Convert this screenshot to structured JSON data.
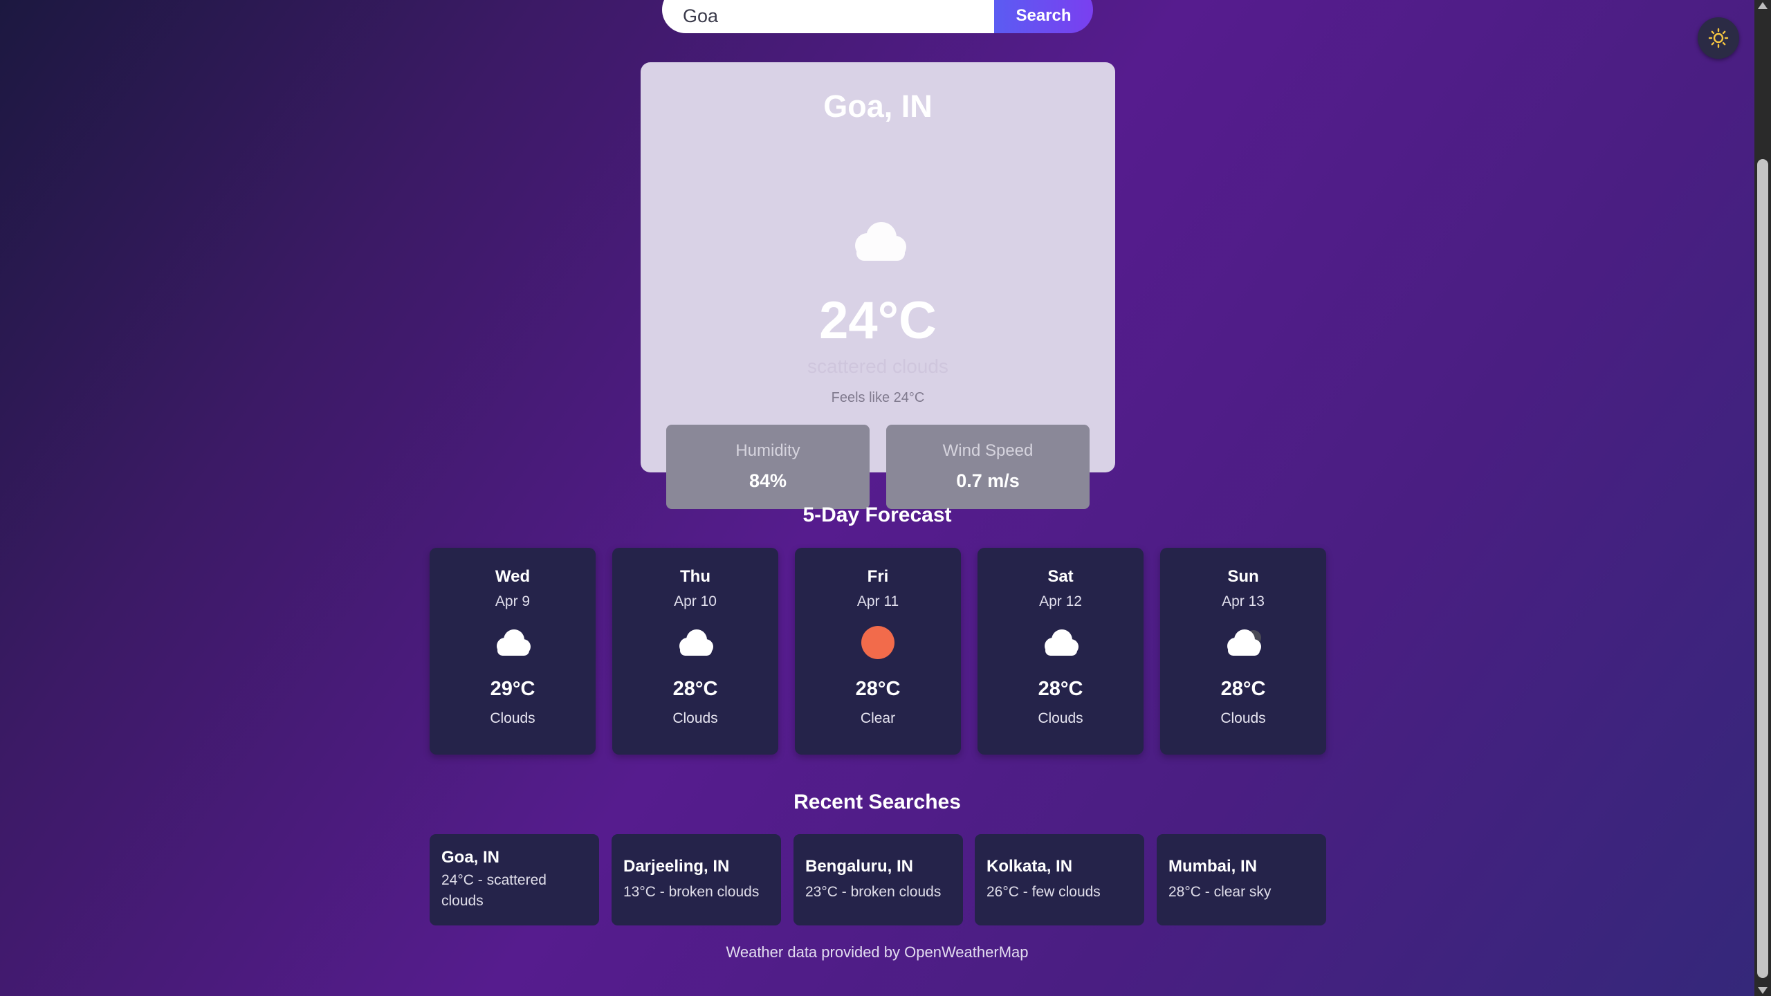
{
  "search": {
    "value": "Goa",
    "button_label": "Search"
  },
  "theme_toggle": {
    "icon": "sun-icon",
    "icon_color": "#f5c542"
  },
  "current": {
    "city": "Goa, IN",
    "icon": "cloud-icon",
    "temperature": "24°C",
    "description": "scattered clouds",
    "feels_like": "Feels like 24°C",
    "humidity_label": "Humidity",
    "humidity_value": "84%",
    "wind_label": "Wind Speed",
    "wind_value": "0.7 m/s"
  },
  "forecast": {
    "title": "5-Day Forecast",
    "days": [
      {
        "day": "Wed",
        "date": "Apr 9",
        "icon": "cloud-icon",
        "temp": "29°C",
        "condition": "Clouds"
      },
      {
        "day": "Thu",
        "date": "Apr 10",
        "icon": "cloud-icon",
        "temp": "28°C",
        "condition": "Clouds"
      },
      {
        "day": "Fri",
        "date": "Apr 11",
        "icon": "sun-icon",
        "temp": "28°C",
        "condition": "Clear"
      },
      {
        "day": "Sat",
        "date": "Apr 12",
        "icon": "cloud-icon",
        "temp": "28°C",
        "condition": "Clouds"
      },
      {
        "day": "Sun",
        "date": "Apr 13",
        "icon": "cloud-icon",
        "temp": "28°C",
        "condition": "Clouds"
      }
    ]
  },
  "recent": {
    "title": "Recent Searches",
    "items": [
      {
        "city": "Goa, IN",
        "info": "24°C - scattered clouds"
      },
      {
        "city": "Darjeeling, IN",
        "info": "13°C - broken clouds"
      },
      {
        "city": "Bengaluru, IN",
        "info": "23°C - broken clouds"
      },
      {
        "city": "Kolkata, IN",
        "info": "26°C - few clouds"
      },
      {
        "city": "Mumbai, IN",
        "info": "28°C - clear sky"
      }
    ]
  },
  "footer": {
    "text": "Weather data provided by OpenWeatherMap"
  },
  "colors": {
    "sun": "#f26b4b",
    "accent": "#6a4cf2",
    "card": "#25234a"
  }
}
